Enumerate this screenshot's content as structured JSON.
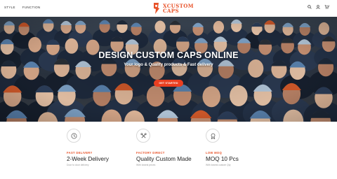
{
  "header": {
    "nav": [
      {
        "label": "STYLE"
      },
      {
        "label": "FUNCTION"
      }
    ],
    "logo": {
      "line1": "XCUSTOM",
      "line2": "CAPS",
      "color": "#e8532a"
    },
    "icons": [
      "search-icon",
      "user-icon",
      "cart-icon"
    ],
    "cart_count": "0"
  },
  "hero": {
    "title": "DESIGN CUSTOM CAPS ONLINE",
    "subtitle": "Your logo & Quality products & Fast delivery",
    "cta_label": "GET STARTED",
    "cta_color": "#ea3f20"
  },
  "features": [
    {
      "icon": "clock-icon",
      "kicker": "FAST DELIVERY",
      "title": "2-Week Delivery",
      "desc": "Door to door delivery"
    },
    {
      "icon": "tools-icon",
      "kicker": "FACTORY DIRECT",
      "title": "Quality Custom Made",
      "desc": "With lowest prices"
    },
    {
      "icon": "badge-icon",
      "kicker": "LOW MOQ",
      "title": "MOQ 10 Pcs",
      "desc": "With lowest custom Qty"
    }
  ]
}
